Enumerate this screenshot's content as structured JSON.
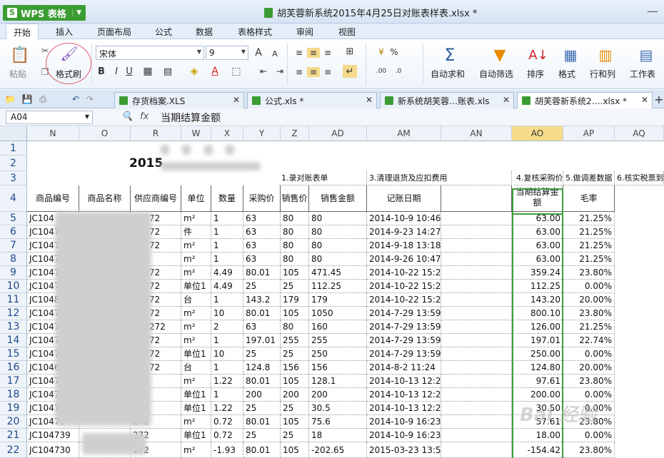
{
  "app": {
    "name": "WPS 表格",
    "logo": "S",
    "doc_title": "胡芙蓉新系统2015年4月25日对账表样表.xlsx *"
  },
  "ribbon_tabs": [
    "开始",
    "插入",
    "页面布局",
    "公式",
    "数据",
    "表格样式",
    "审阅",
    "视图"
  ],
  "ribbon": {
    "paste": "粘贴",
    "format_painter": "格式刷",
    "font": "宋体",
    "font_size": "9",
    "bold": "B",
    "italic": "I",
    "underline": "U",
    "currency": "%",
    "autosum": "自动求和",
    "autofilter": "自动筛选",
    "sort": "排序",
    "format": "格式",
    "rowcol": "行和列",
    "sheet": "工作表"
  },
  "doc_tabs": [
    "存货档案.XLS",
    "公式.xls *",
    "新系统胡芙蓉…账表.xls",
    "胡芙蓉新系统2….xlsx *"
  ],
  "formula_bar": {
    "cell_ref": "A04",
    "fx": "fx",
    "content": "当期结算金额"
  },
  "columns": [
    "N",
    "O",
    "R",
    "W",
    "X",
    "Y",
    "Z",
    "AD",
    "AM",
    "AN",
    "AO",
    "AP",
    "AQ"
  ],
  "rows": [
    "1",
    "2",
    "3",
    "4",
    "5",
    "6",
    "7",
    "8",
    "9",
    "10",
    "11",
    "12",
    "13",
    "14",
    "15",
    "16",
    "17",
    "18",
    "19",
    "20",
    "21",
    "22"
  ],
  "row2_title": "2015",
  "row3_notes": [
    "1.录对账表单",
    "3.清理退货及应扣费用",
    "4.复核采购价",
    "5.做调差数据",
    "6.核实税票到"
  ],
  "headers": [
    "商品编号",
    "商品名称",
    "供应商编号",
    "单位",
    "数量",
    "采购价",
    "销售价",
    "销售金额",
    "记账日期",
    "",
    "当期结算金额",
    "毛率"
  ],
  "data_rows": [
    [
      "JC104",
      "",
      "00272",
      "m²",
      "1",
      "63",
      "80",
      "80",
      "2014-10-9 10:46",
      "",
      "63.00",
      "21.25%"
    ],
    [
      "JC10476",
      "",
      "00272",
      "件",
      "1",
      "63",
      "80",
      "80",
      "2014-9-23 14:27",
      "",
      "63.00",
      "21.25%"
    ],
    [
      "JC104733",
      "",
      "00272",
      "m²",
      "1",
      "63",
      "80",
      "80",
      "2014-9-18 13:18",
      "",
      "63.00",
      "21.25%"
    ],
    [
      "JC104733",
      "",
      "2",
      "m²",
      "1",
      "63",
      "80",
      "80",
      "2014-9-26 10:47",
      "",
      "63.00",
      "21.25%"
    ],
    [
      "JC10473",
      "",
      "00272",
      "m²",
      "4.49",
      "80.01",
      "105",
      "471.45",
      "2014-10-22 15:24",
      "",
      "359.24",
      "23.80%"
    ],
    [
      "JC104739",
      "",
      "00272",
      "单位1",
      "4.49",
      "25",
      "25",
      "112.25",
      "2014-10-22 15:24",
      "",
      "112.25",
      "0.00%"
    ],
    [
      "JC104826",
      "",
      "00272",
      "台",
      "1",
      "143.2",
      "179",
      "179",
      "2014-10-22 15:24",
      "",
      "143.20",
      "20.00%"
    ],
    [
      "JC104730",
      "",
      "00272",
      "m²",
      "10",
      "80.01",
      "105",
      "1050",
      "2014-7-29 13:59",
      "",
      "800.10",
      "23.80%"
    ],
    [
      "JC10473",
      "",
      "100272",
      "m²",
      "2",
      "63",
      "80",
      "160",
      "2014-7-29 13:59",
      "",
      "126.00",
      "21.25%"
    ],
    [
      "JC10473",
      "",
      "00272",
      "m²",
      "1",
      "197.01",
      "255",
      "255",
      "2014-7-29 13:59",
      "",
      "197.01",
      "22.74%"
    ],
    [
      "JC104739",
      "",
      "00272",
      "单位1",
      "10",
      "25",
      "25",
      "250",
      "2014-7-29 13:59",
      "",
      "250.00",
      "0.00%"
    ],
    [
      "JC104655",
      "",
      "00272",
      "台",
      "1",
      "124.8",
      "156",
      "156",
      "2014-8-2 11:24",
      "",
      "124.80",
      "20.00%"
    ],
    [
      "JC104730",
      "",
      "272",
      "m²",
      "1.22",
      "80.01",
      "105",
      "128.1",
      "2014-10-13 12:26",
      "",
      "97.61",
      "23.80%"
    ],
    [
      "JC104738",
      "",
      "272",
      "单位1",
      "1",
      "200",
      "200",
      "200",
      "2014-10-13 12:26",
      "",
      "200.00",
      "0.00%"
    ],
    [
      "JC10473",
      "",
      "272",
      "单位1",
      "1.22",
      "25",
      "25",
      "30.5",
      "2014-10-13 12:26",
      "",
      "30.50",
      "0.00%"
    ],
    [
      "JC10473",
      "",
      "272",
      "m²",
      "0.72",
      "80.01",
      "105",
      "75.6",
      "2014-10-9 16:23",
      "",
      "57.61",
      "23.80%"
    ],
    [
      "JC104739",
      "",
      "272",
      "单位1",
      "0.72",
      "25",
      "25",
      "18",
      "2014-10-9 16:23",
      "",
      "18.00",
      "0.00%"
    ],
    [
      "JC104730",
      "",
      "272",
      "m²",
      "-1.93",
      "80.01",
      "105",
      "-202.65",
      "2015-03-23 13:54",
      "",
      "-154.42",
      "23.80%"
    ]
  ],
  "watermark": "Bai 经验",
  "colors": {
    "green": "#3d9d3a",
    "selected_col": "#f7dc8a",
    "row_header_text": "#1d4a8a"
  }
}
